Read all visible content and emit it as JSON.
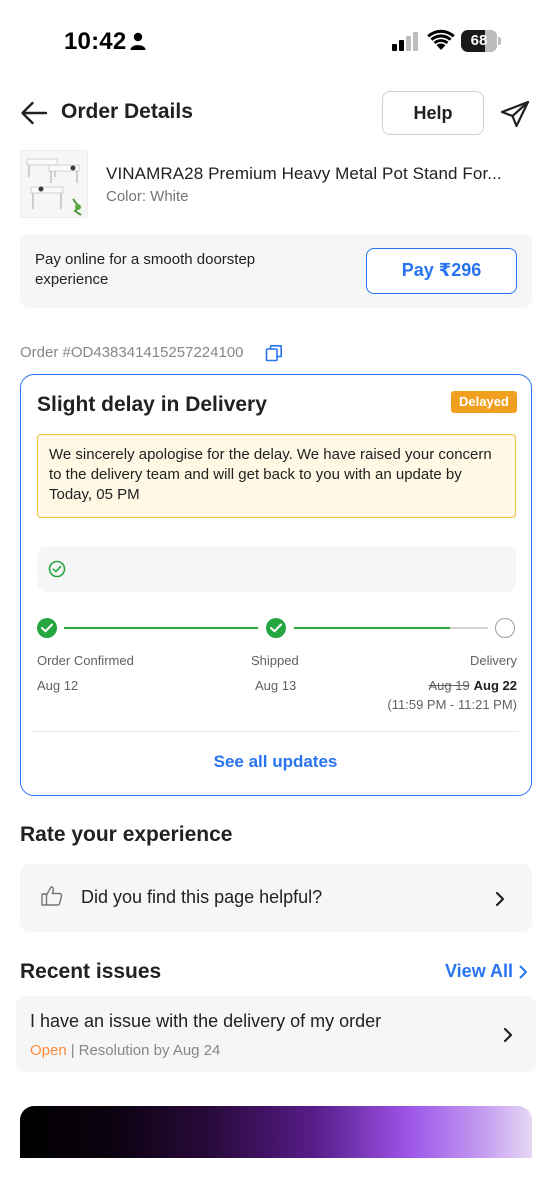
{
  "status_bar": {
    "time": "10:42",
    "battery": "68",
    "battery_level": 0.68
  },
  "header": {
    "title": "Order Details",
    "help_label": "Help"
  },
  "product": {
    "name": "VINAMRA28 Premium Heavy Metal Pot Stand For...",
    "color": "Color: White"
  },
  "pay_banner": {
    "text": "Pay online for a smooth doorstep experience",
    "button_label": "Pay ₹296"
  },
  "order": {
    "id_text": "Order #OD438341415257224100"
  },
  "delivery_card": {
    "title": "Slight delay in Delivery",
    "badge": "Delayed",
    "apology": "We sincerely apologise for the delay. We have raised your concern to the delivery team and will get back to you with an update by Today, 05 PM",
    "steps": [
      {
        "label": "Order Confirmed",
        "date": "Aug 12",
        "done": true
      },
      {
        "label": "Shipped",
        "date": "Aug 13",
        "done": true
      },
      {
        "label": "Delivery",
        "old_date": "Aug 19",
        "new_date": "Aug 22",
        "time_window": "(11:59 PM - 11:21 PM)",
        "done": false
      }
    ],
    "see_all_label": "See all updates"
  },
  "rate": {
    "title": "Rate your experience",
    "question": "Did you find this page helpful?"
  },
  "recent_issues": {
    "title": "Recent issues",
    "view_all_label": "View All",
    "issue": {
      "text": "I have an issue with the delivery of my order",
      "status": "Open",
      "separator": "|",
      "resolution": "Resolution by Aug 24"
    }
  },
  "colors": {
    "brand_blue": "#2874f0",
    "success_green": "#26a541",
    "delay_orange": "#f0a01e",
    "open_orange": "#ff8a3d"
  }
}
